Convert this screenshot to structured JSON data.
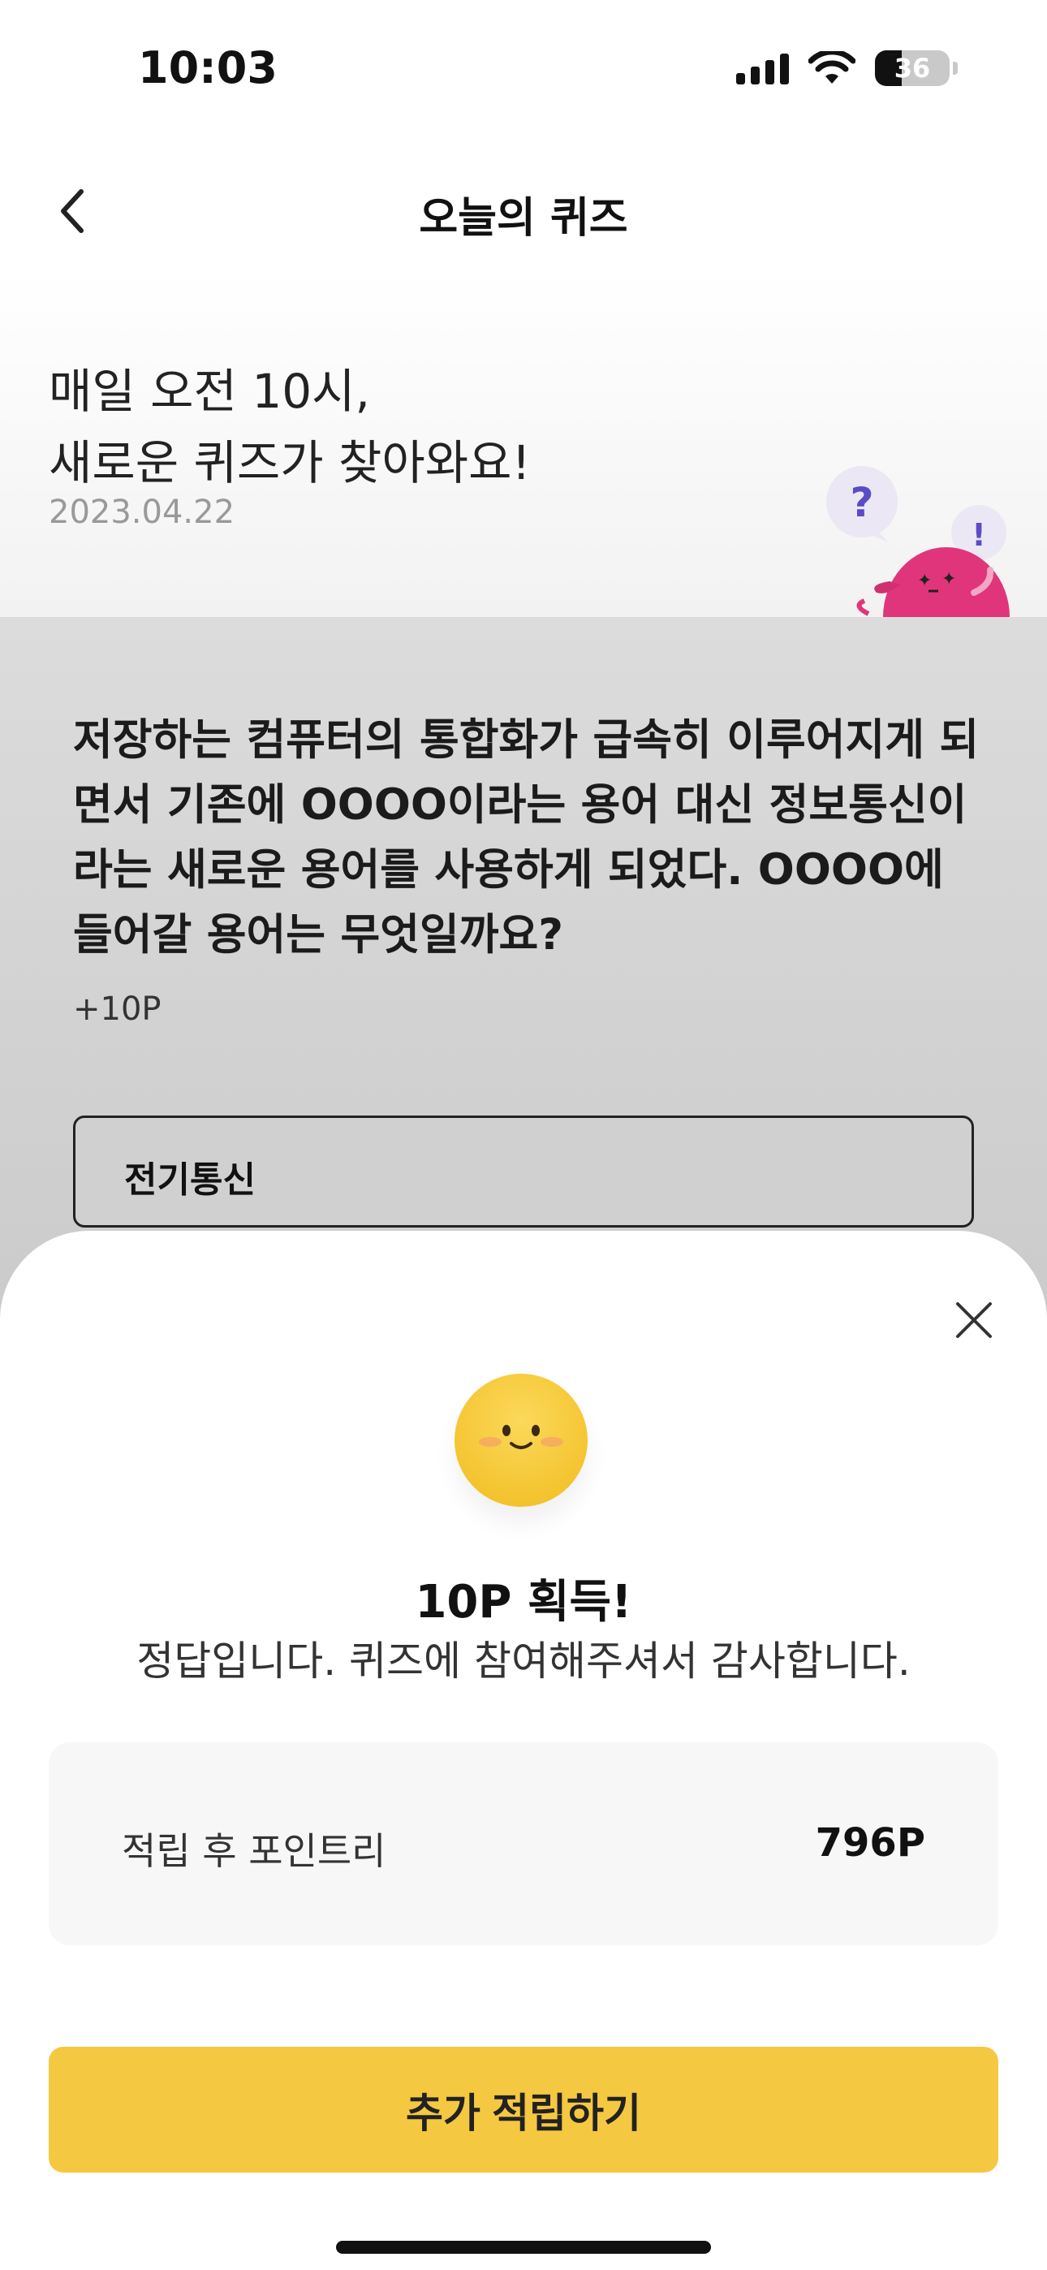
{
  "status_bar": {
    "time": "10:03",
    "battery": "36"
  },
  "header": {
    "title": "오늘의 퀴즈"
  },
  "intro": {
    "title_line1": "매일 오전 10시,",
    "title_line2": "새로운 퀴즈가 찾아와요!",
    "date": "2023.04.22",
    "mascot_marks": {
      "question": "?",
      "exclaim": "!"
    }
  },
  "quiz": {
    "question": "저장하는 컴퓨터의 통합화가 급속히 이루어지게 되면서 기존에 OOOO이라는 용어 대신 정보통신이라는 새로운 용어를 사용하게 되었다. OOOO에 들어갈 용어는 무엇일까요?",
    "points": "+10P",
    "options": [
      {
        "label": "전기통신"
      }
    ]
  },
  "result_sheet": {
    "title": "10P 획득!",
    "message": "정답입니다. 퀴즈에 참여해주셔서 감사합니다.",
    "points_label": "적립 후 포인트리",
    "points_value": "796P",
    "cta_label": "추가 적립하기"
  },
  "colors": {
    "accent": "#F5C842",
    "mascot": "#E0357A",
    "bubble": "#EBE7F4",
    "bubble_text": "#5B4BC4"
  },
  "icons": [
    "back-chevron-icon",
    "close-icon",
    "smiley-icon",
    "signal-icon",
    "wifi-icon",
    "battery-icon"
  ]
}
